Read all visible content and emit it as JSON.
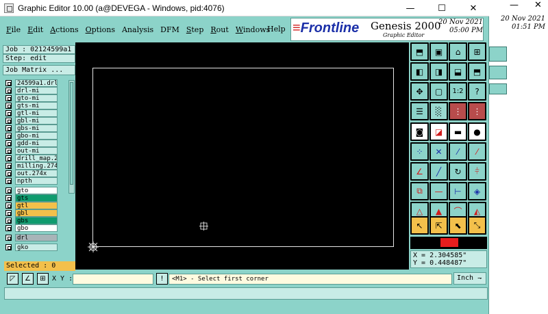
{
  "window": {
    "title": "Graphic Editor 10.00 (a@DEVEGA - Windows, pid:4076)",
    "minimize": "—",
    "maximize": "☐",
    "close": "✕"
  },
  "menu": {
    "items": [
      {
        "ul": "F",
        "rest": "ile"
      },
      {
        "ul": "E",
        "rest": "dit"
      },
      {
        "ul": "A",
        "rest": "ctions"
      },
      {
        "ul": "O",
        "rest": "ptions"
      },
      {
        "ul": "",
        "rest": "Analysis"
      },
      {
        "ul": "",
        "rest": "DFM"
      },
      {
        "ul": "S",
        "rest": "tep"
      },
      {
        "ul": "R",
        "rest": "out"
      },
      {
        "ul": "W",
        "rest": "indows"
      }
    ],
    "help": "Help"
  },
  "brand": {
    "logo": "Frontline",
    "product": "Genesis 2000",
    "subtitle": "Graphic Editor",
    "date_line1": "20 Nov 2021",
    "date_line2": "05:00 PM"
  },
  "background_window": {
    "close": "✕",
    "date_line1": "20 Nov 2021",
    "date_line2": "01:51 PM"
  },
  "left": {
    "job": "Job : 02124599a1",
    "step": "Step: edit",
    "job_matrix": "Job Matrix ...",
    "layers_group1": [
      "24599a1.drl",
      "drl-mi",
      "gto-mi",
      "gts-mi",
      "gtl-mi",
      "gbl-mi",
      "gbs-mi",
      "gbo-mi",
      "gdd-mi",
      "out-mi",
      "drill_map.274",
      "milling.274x",
      "out.274x",
      "npth"
    ],
    "layers_group2": [
      {
        "name": "gto",
        "color": "#ffffff"
      },
      {
        "name": "gts",
        "color": "#0f9b6e"
      },
      {
        "name": "gtl",
        "color": "#f3c04b"
      },
      {
        "name": "gbl",
        "color": "#f3c04b"
      },
      {
        "name": "gbs",
        "color": "#0f9b6e"
      },
      {
        "name": "gbo",
        "color": "#ffffff"
      }
    ],
    "layers_group3": [
      {
        "name": "drl",
        "color": "#a8b4b8"
      }
    ],
    "layers_group4": [
      {
        "name": "gko",
        "color": "#c8ece6"
      }
    ],
    "selected": "Selected : 0"
  },
  "coords": {
    "x": "X = 2.304585\"",
    "y": "Y = 0.448487\""
  },
  "bottom": {
    "xy_label": "X Y :",
    "xy_value": "",
    "message": "<M1> - Select first corner",
    "unit": "Inch"
  },
  "colors": {
    "panel": "#8cd3c9",
    "canvas": "#000000",
    "highlight": "#f3c04b",
    "accent_red": "#e61e1e"
  }
}
